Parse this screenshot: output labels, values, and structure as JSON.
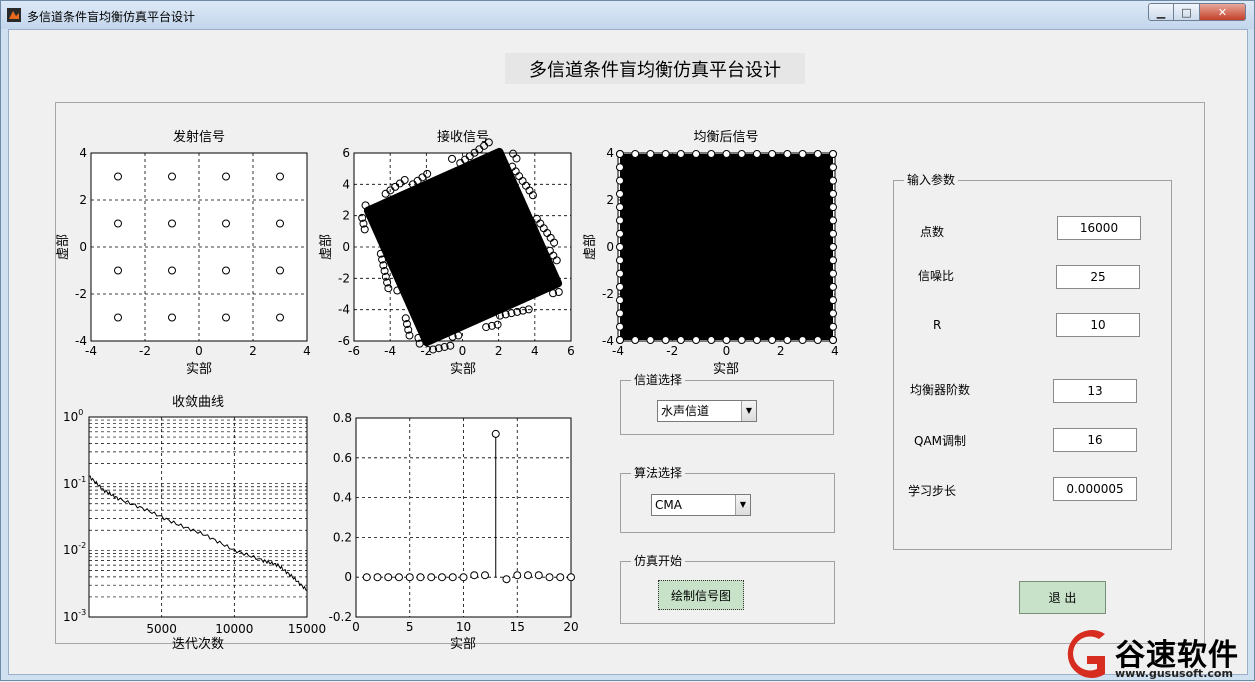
{
  "window": {
    "title": "多信道条件盲均衡仿真平台设计",
    "controls": {
      "minimize": "▁",
      "maximize": "□",
      "close": "✕"
    }
  },
  "app": {
    "title": "多信道条件盲均衡仿真平台设计"
  },
  "plots": {
    "tx": {
      "title": "发射信号",
      "xlabel": "实部",
      "ylabel": "虚部",
      "xticks": [
        "-4",
        "-2",
        "0",
        "2",
        "4"
      ],
      "yticks": [
        "4",
        "2",
        "0",
        "-2",
        "-4"
      ]
    },
    "rx": {
      "title": "接收信号",
      "xlabel": "实部",
      "ylabel": "虚部",
      "xticks": [
        "-6",
        "-4",
        "-2",
        "0",
        "2",
        "4",
        "6"
      ],
      "yticks": [
        "6",
        "4",
        "2",
        "0",
        "-2",
        "-4",
        "-6"
      ]
    },
    "eq": {
      "title": "均衡后信号",
      "xlabel": "实部",
      "ylabel": "虚部",
      "xticks": [
        "-4",
        "-2",
        "0",
        "2",
        "4"
      ],
      "yticks": [
        "4",
        "2",
        "0",
        "-2",
        "-4"
      ]
    },
    "conv": {
      "title": "收敛曲线",
      "xlabel": "迭代次数",
      "xticks": [
        "5000",
        "10000",
        "15000"
      ]
    },
    "taps": {
      "xlabel": "实部",
      "xticks": [
        "0",
        "5",
        "10",
        "15",
        "20"
      ],
      "yticks": [
        "0.8",
        "0.6",
        "0.4",
        "0.2",
        "0",
        "-0.2"
      ]
    }
  },
  "chart_data": [
    {
      "type": "scatter",
      "title": "发射信号",
      "xlabel": "实部",
      "ylabel": "虚部",
      "xlim": [
        -4,
        4
      ],
      "ylim": [
        -4,
        4
      ],
      "grid": true,
      "x": [
        -3,
        -1,
        1,
        3,
        -3,
        -1,
        1,
        3,
        -3,
        -1,
        1,
        3,
        -3,
        -1,
        1,
        3
      ],
      "y": [
        3,
        3,
        3,
        3,
        1,
        1,
        1,
        1,
        -1,
        -1,
        -1,
        -1,
        -3,
        -3,
        -3,
        -3
      ]
    },
    {
      "type": "scatter",
      "title": "接收信号",
      "xlabel": "实部",
      "ylabel": "虚部",
      "xlim": [
        -6,
        6
      ],
      "ylim": [
        -6,
        6
      ],
      "grid": true
    },
    {
      "type": "scatter",
      "title": "均衡后信号",
      "xlabel": "实部",
      "ylabel": "虚部",
      "xlim": [
        -4,
        4
      ],
      "ylim": [
        -4,
        4
      ],
      "grid": true
    },
    {
      "type": "line",
      "title": "收敛曲线",
      "xlabel": "迭代次数",
      "xlim": [
        0,
        15000
      ],
      "ylim": [
        0.001,
        1
      ],
      "yscale": "log",
      "grid": true,
      "x": [
        0,
        1000,
        2000,
        4000,
        6000,
        8000,
        10000,
        12000,
        13000,
        14000,
        15000
      ],
      "y": [
        0.13,
        0.08,
        0.06,
        0.04,
        0.025,
        0.017,
        0.01,
        0.007,
        0.006,
        0.004,
        0.0025
      ]
    },
    {
      "type": "stem",
      "xlabel": "实部",
      "xlim": [
        0,
        20
      ],
      "ylim": [
        -0.2,
        0.8
      ],
      "grid": true,
      "x": [
        1,
        2,
        3,
        4,
        5,
        6,
        7,
        8,
        9,
        10,
        11,
        12,
        13,
        14,
        15,
        16,
        17,
        18,
        19,
        20
      ],
      "y": [
        0,
        0,
        0,
        0,
        0,
        0,
        0,
        0,
        0,
        0,
        0.01,
        0.01,
        0.72,
        -0.01,
        0.01,
        0.01,
        0.01,
        0,
        0,
        0
      ]
    }
  ],
  "channel": {
    "label": "信道选择",
    "value": "水声信道"
  },
  "algorithm": {
    "label": "算法选择",
    "value": "CMA"
  },
  "sim": {
    "label": "仿真开始",
    "button": "绘制信号图"
  },
  "params": {
    "label": "输入参数",
    "points": {
      "label": "点数",
      "value": "16000"
    },
    "snr": {
      "label": "信噪比",
      "value": "25"
    },
    "r": {
      "label": "R",
      "value": "10"
    },
    "order": {
      "label": "均衡器阶数",
      "value": "13"
    },
    "qam": {
      "label": "QAM调制",
      "value": "16"
    },
    "step": {
      "label": "学习步长",
      "value": "0.000005"
    }
  },
  "exit": {
    "label": "退 出"
  },
  "watermark": {
    "text": "谷速软件",
    "url": "www.gususoft.com",
    "color": "#d62d20"
  }
}
